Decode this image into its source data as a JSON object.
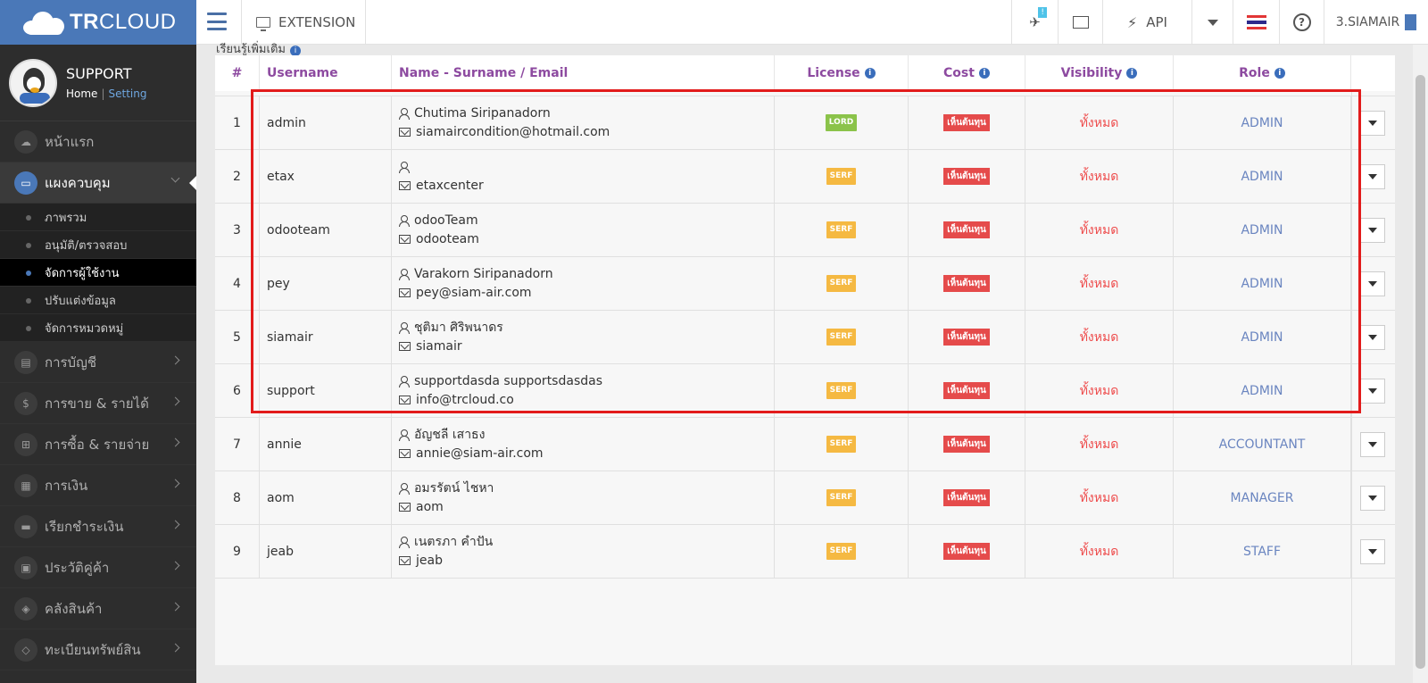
{
  "app": {
    "brand_bold": "TR",
    "brand_rest": "CLOUD"
  },
  "topbar": {
    "extension_label": "EXTENSION",
    "notif_badge": "!",
    "api_label": "API",
    "help_label": "?",
    "company": "3.SIAMAIR"
  },
  "sidebar": {
    "profile": {
      "name": "SUPPORT",
      "home": "Home",
      "setting": "Setting"
    },
    "items": [
      {
        "label": "หน้าแรก",
        "icon": "cloud-icon"
      },
      {
        "label": "แผงควบคุม",
        "icon": "monitor-icon"
      },
      {
        "label": "การบัญชี",
        "icon": "book-icon"
      },
      {
        "label": "การขาย & รายได้",
        "icon": "dollar-icon"
      },
      {
        "label": "การซื้อ & รายจ่าย",
        "icon": "cart-icon"
      },
      {
        "label": "การเงิน",
        "icon": "calendar-icon"
      },
      {
        "label": "เรียกชำระเงิน",
        "icon": "card-icon"
      },
      {
        "label": "ประวัติคู่ค้า",
        "icon": "contact-icon"
      },
      {
        "label": "คลังสินค้า",
        "icon": "cubes-icon"
      },
      {
        "label": "ทะเบียนทรัพย์สิน",
        "icon": "diamond-icon"
      }
    ],
    "submenu": [
      "ภาพรวม",
      "อนุมัติ/ตรวจสอบ",
      "จัดการผู้ใช้งาน",
      "ปรับแต่งข้อมูล",
      "จัดการหมวดหมู่"
    ]
  },
  "main": {
    "crumb": "เรียนรู้เพิ่มเติม",
    "table": {
      "headers": {
        "num": "#",
        "username": "Username",
        "name": "Name - Surname / Email",
        "license": "License",
        "cost": "Cost",
        "visibility": "Visibility",
        "role": "Role"
      },
      "rows": [
        {
          "num": "1",
          "username": "admin",
          "name": "Chutima Siripanadorn",
          "email": "siamaircondition@hotmail.com",
          "license": "LORD",
          "cost": "เห็นต้นทุน",
          "visibility": "ทั้งหมด",
          "role": "ADMIN"
        },
        {
          "num": "2",
          "username": "etax",
          "name": "",
          "email": "etaxcenter",
          "license": "SERF",
          "cost": "เห็นต้นทุน",
          "visibility": "ทั้งหมด",
          "role": "ADMIN"
        },
        {
          "num": "3",
          "username": "odooteam",
          "name": "odooTeam",
          "email": "odooteam",
          "license": "SERF",
          "cost": "เห็นต้นทุน",
          "visibility": "ทั้งหมด",
          "role": "ADMIN"
        },
        {
          "num": "4",
          "username": "pey",
          "name": "Varakorn Siripanadorn",
          "email": "pey@siam-air.com",
          "license": "SERF",
          "cost": "เห็นต้นทุน",
          "visibility": "ทั้งหมด",
          "role": "ADMIN"
        },
        {
          "num": "5",
          "username": "siamair",
          "name": "ชุติมา ศิริพนาดร",
          "email": "siamair",
          "license": "SERF",
          "cost": "เห็นต้นทุน",
          "visibility": "ทั้งหมด",
          "role": "ADMIN"
        },
        {
          "num": "6",
          "username": "support",
          "name": "supportdasda supportsdasdas",
          "email": "info@trcloud.co",
          "license": "SERF",
          "cost": "เห็นต้นทุน",
          "visibility": "ทั้งหมด",
          "role": "ADMIN"
        },
        {
          "num": "7",
          "username": "annie",
          "name": "อัญชลี เสาธง",
          "email": "annie@siam-air.com",
          "license": "SERF",
          "cost": "เห็นต้นทุน",
          "visibility": "ทั้งหมด",
          "role": "ACCOUNTANT"
        },
        {
          "num": "8",
          "username": "aom",
          "name": "อมรรัตน์ ไชหา",
          "email": "aom",
          "license": "SERF",
          "cost": "เห็นต้นทุน",
          "visibility": "ทั้งหมด",
          "role": "MANAGER"
        },
        {
          "num": "9",
          "username": "jeab",
          "name": "เนตรภา คำปัน",
          "email": "jeab",
          "license": "SERF",
          "cost": "เห็นต้นทุน",
          "visibility": "ทั้งหมด",
          "role": "STAFF"
        }
      ]
    }
  },
  "colors": {
    "brand": "#4a78b8",
    "header_text": "#8d4aa0",
    "lord": "#8bc34a",
    "serf": "#f5b942",
    "cost": "#e54b4b",
    "visibility": "#ee4e4e",
    "role": "#6a85c0",
    "highlight": "#e21b1b"
  }
}
